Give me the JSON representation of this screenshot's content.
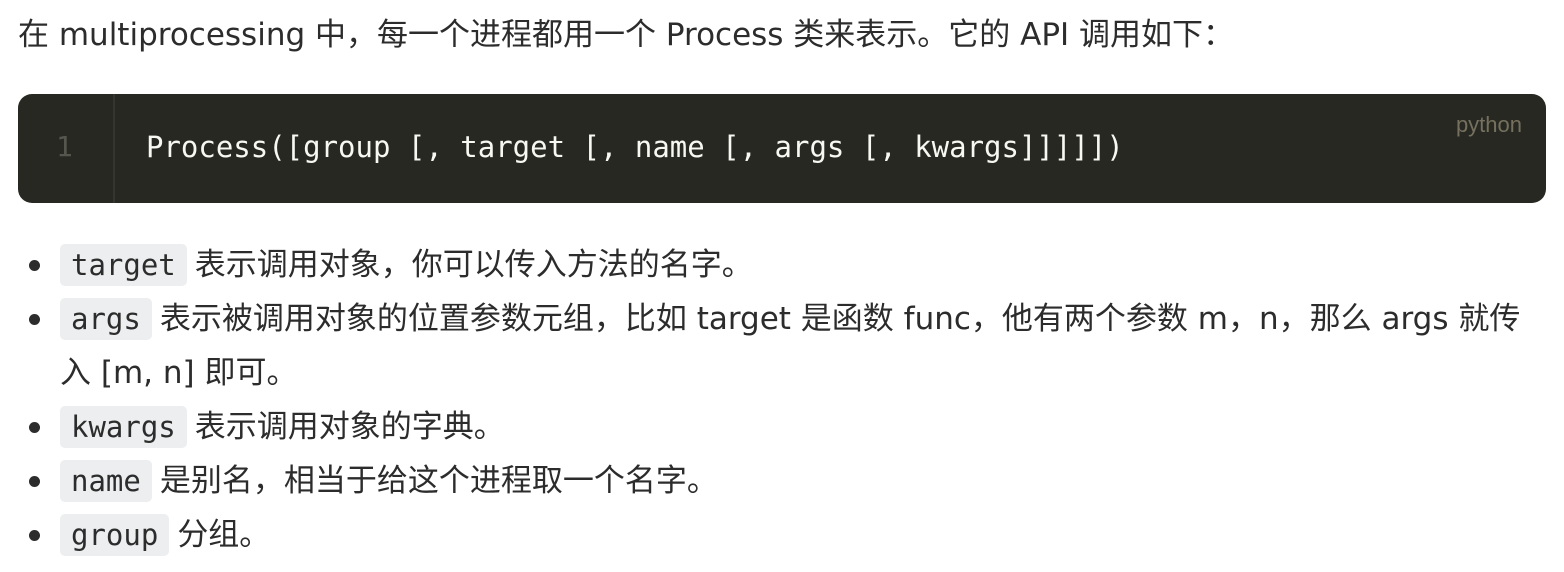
{
  "intro": "在 multiprocessing 中，每一个进程都用一个 Process 类来表示。它的 API 调用如下：",
  "code_block": {
    "line_number": "1",
    "code": "Process([group [, target [, name [, args [, kwargs]]]]])",
    "language": "python"
  },
  "params": [
    {
      "code": "target",
      "text": "表示调用对象，你可以传入方法的名字。"
    },
    {
      "code": "args",
      "text": "表示被调用对象的位置参数元组，比如 target 是函数 func，他有两个参数 m，n，那么 args 就传入 [m, n] 即可。"
    },
    {
      "code": "kwargs",
      "text": "表示调用对象的字典。"
    },
    {
      "code": "name",
      "text": "是别名，相当于给这个进程取一个名字。"
    },
    {
      "code": "group",
      "text": "分组。"
    }
  ]
}
